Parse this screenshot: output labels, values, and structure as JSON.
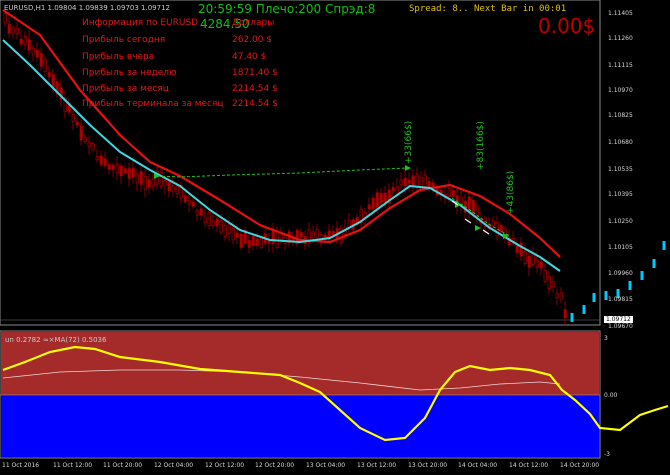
{
  "chart_caption": "EURUSD,H1  1.09804 1.09839 1.09703 1.09712",
  "clock_leverage": "20:59:59 Плечо:200 Спрэд:8",
  "balance_number": "4284.50",
  "spread_status": "Spread: 8.. Next Bar in 00:01",
  "profit_big": "0.00$",
  "info_rows": [
    {
      "label": "Информация по EURUSD",
      "value": "Доллары"
    },
    {
      "label": "Прибыль сегодня",
      "value": "262.00 $"
    },
    {
      "label": "Прибыль вчера",
      "value": "47.40 $"
    },
    {
      "label": "Прибыль за неделю",
      "value": "1871.40 $"
    },
    {
      "label": "Прибыль за месяц",
      "value": "2214.54 $"
    },
    {
      "label": "Прибыль терминала за месяц",
      "value": "2214.54 $"
    }
  ],
  "trade_labels": [
    "+33(66$)",
    "+83(166$)",
    "+43(86$)"
  ],
  "price_ticks": [
    "1.11405",
    "1.11260",
    "1.11115",
    "1.10970",
    "1.10825",
    "1.10680",
    "1.10535",
    "1.10395",
    "1.10250",
    "1.10105",
    "1.09960",
    "1.09815",
    "1.09670"
  ],
  "current_price": "1.09712",
  "indicator_caption": "un 0.2782  ≈×MA(72) 0.5036",
  "indicator_ticks": [
    "3",
    "0.00",
    "-3"
  ],
  "time_ticks": [
    "11 Oct 2016",
    "11 Oct 12:00",
    "11 Oct 20:00",
    "12 Oct 04:00",
    "12 Oct 12:00",
    "12 Oct 20:00",
    "13 Oct 04:00",
    "13 Oct 12:00",
    "13 Oct 20:00",
    "14 Oct 04:00",
    "14 Oct 12:00",
    "14 Oct 20:00"
  ],
  "colors": {
    "up_zone": "#a52b2b",
    "down_zone": "#0000ff",
    "red_ma": "#e81010",
    "cyan_ma": "#40d8e0",
    "osc": "#ffff00",
    "trade_green": "#20c020"
  }
}
